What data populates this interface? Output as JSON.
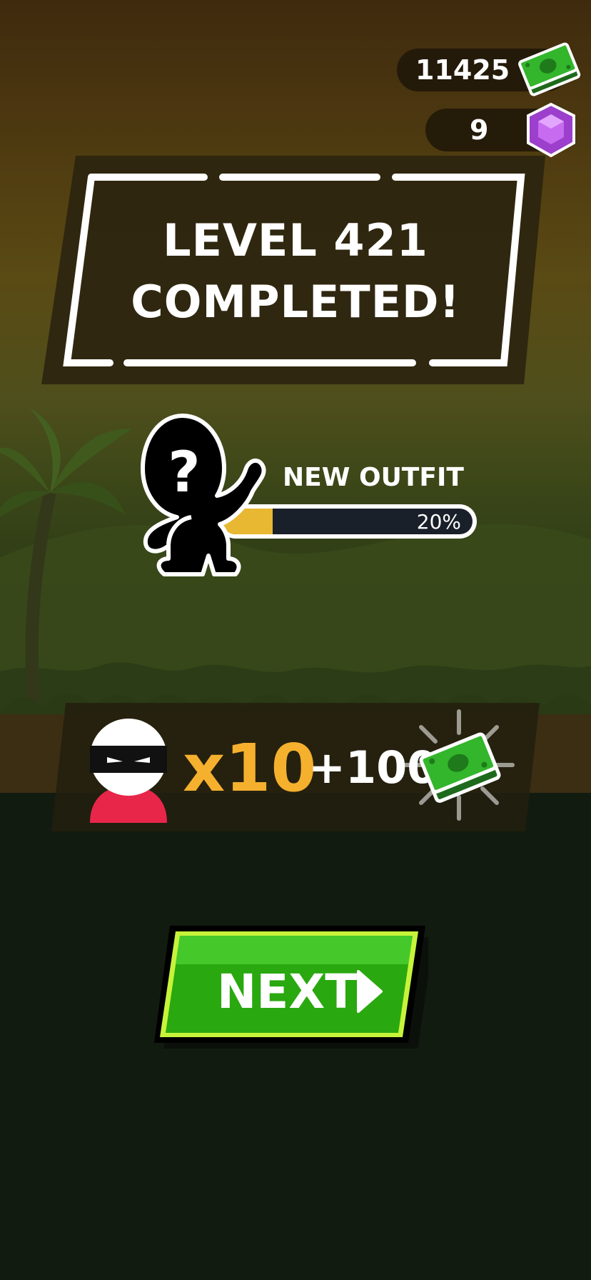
{
  "currency": {
    "money_amount": "11425",
    "money_icon": "cash-stack-icon",
    "gems_amount": "9",
    "gem_icon": "purple-gem-icon"
  },
  "level_banner": {
    "line1": "LEVEL 421",
    "line2": "COMPLETED!"
  },
  "outfit": {
    "label": "NEW OUTFIT",
    "progress_text": "20%",
    "progress": 0.2,
    "icon": "mystery-character-icon"
  },
  "reward": {
    "avatar_icon": "ninja-avatar-icon",
    "multiplier": "x10",
    "amount": "+100",
    "icon": "cash-stack-icon"
  },
  "next_button": {
    "label": "NEXT",
    "icon": "play-arrow-icon"
  },
  "colors": {
    "accent_gold": "#f5b02e",
    "button_green": "#2aa80f",
    "button_border": "#c7f43a",
    "gem_purple": "#b04ad8",
    "cash_green": "#2fae2a"
  }
}
